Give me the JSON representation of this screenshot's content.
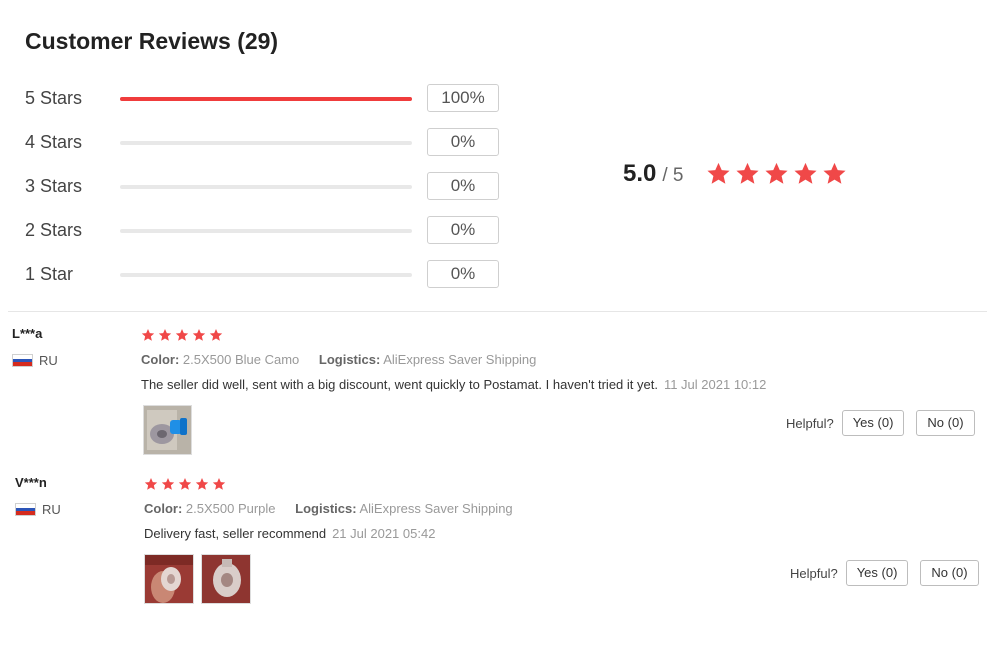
{
  "reviews_header": {
    "title": "Customer Reviews (29)",
    "distribution": [
      {
        "label": "5 Stars",
        "percent_text": "100%",
        "fraction": 1.0
      },
      {
        "label": "4 Stars",
        "percent_text": "0%",
        "fraction": 0
      },
      {
        "label": "3 Stars",
        "percent_text": "0%",
        "fraction": 0
      },
      {
        "label": "2 Stars",
        "percent_text": "0%",
        "fraction": 0
      },
      {
        "label": "1 Star",
        "percent_text": "0%",
        "fraction": 0
      }
    ],
    "score": "5.0",
    "score_out_of": "/ 5",
    "score_stars": 5
  },
  "colors": {
    "accent_red": "#f04848",
    "bar_fill": "#f03c3c"
  },
  "reviews": [
    {
      "reviewer": "L***a",
      "country": "RU",
      "flag_icon": "russia-flag-icon",
      "stars": 5,
      "color_label": "Color:",
      "color_value": "2.5X500 Blue Camo",
      "logistics_label": "Logistics:",
      "logistics_value": "AliExpress Saver Shipping",
      "text": "The seller did well, sent with a big discount, went quickly to Postamat. I haven't tried it yet.",
      "date": "11 Jul 2021 10:12",
      "photos": [
        "review-photo-blue-spool"
      ],
      "helpful_label": "Helpful?",
      "yes_label": "Yes (0)",
      "no_label": "No (0)"
    },
    {
      "reviewer": "V***n",
      "country": "RU",
      "flag_icon": "russia-flag-icon",
      "stars": 5,
      "color_label": "Color:",
      "color_value": "2.5X500 Purple",
      "logistics_label": "Logistics:",
      "logistics_value": "AliExpress Saver Shipping",
      "text": "Delivery fast, seller recommend",
      "date": "21 Jul 2021 05:42",
      "photos": [
        "review-photo-spool-in-hand",
        "review-photo-spool"
      ],
      "helpful_label": "Helpful?",
      "yes_label": "Yes (0)",
      "no_label": "No (0)"
    }
  ]
}
